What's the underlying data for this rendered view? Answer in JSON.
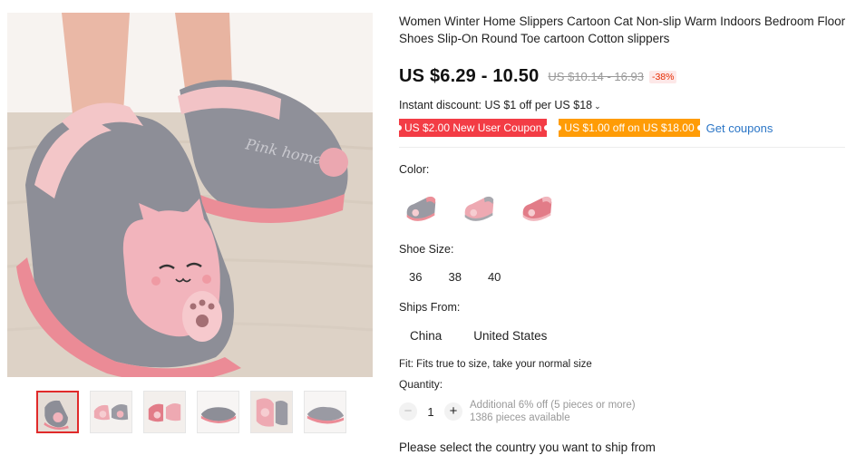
{
  "product": {
    "title": "Women Winter Home Slippers Cartoon Cat Non-slip Warm Indoors Bedroom Floor Shoes Slip-On Round Toe cartoon Cotton slippers",
    "price": "US $6.29 - 10.50",
    "original_price": "US $10.14 - 16.93",
    "discount": "-38%"
  },
  "promo": {
    "instant_discount": "Instant discount: US $1 off per US $18",
    "coupons": [
      "US $2.00 New User Coupon",
      "US $1.00 off on US $18.00"
    ],
    "get_coupons": "Get coupons"
  },
  "options": {
    "color_label": "Color:",
    "colors": [
      {
        "name": "gray-pink",
        "upper": "#9a9aa3",
        "sole": "#ec8f98"
      },
      {
        "name": "pink-gray",
        "upper": "#eea9b2",
        "sole": "#a8a8ae"
      },
      {
        "name": "rose",
        "upper": "#e27c88",
        "sole": "#f1b6bd"
      }
    ],
    "size_label": "Shoe Size:",
    "sizes": [
      "36",
      "38",
      "40"
    ],
    "ships_label": "Ships From:",
    "ships_from": [
      "China",
      "United States"
    ]
  },
  "fit": "Fit: Fits true to size, take your normal size",
  "quantity": {
    "label": "Quantity:",
    "value": "1",
    "minus": "−",
    "plus": "+",
    "additional": "Additional 6% off (5 pieces or more)",
    "available": "1386 pieces available"
  },
  "shipping_prompt": "Please select the country you want to ship from",
  "icons": {
    "chevron": "chevron-down-icon"
  },
  "colors": {
    "coupon_red": "#f33c45",
    "coupon_orange": "#ff9c06",
    "link": "#2a75c6",
    "discount_text": "#e62e04",
    "active_thumb_border": "#e02a2a"
  }
}
